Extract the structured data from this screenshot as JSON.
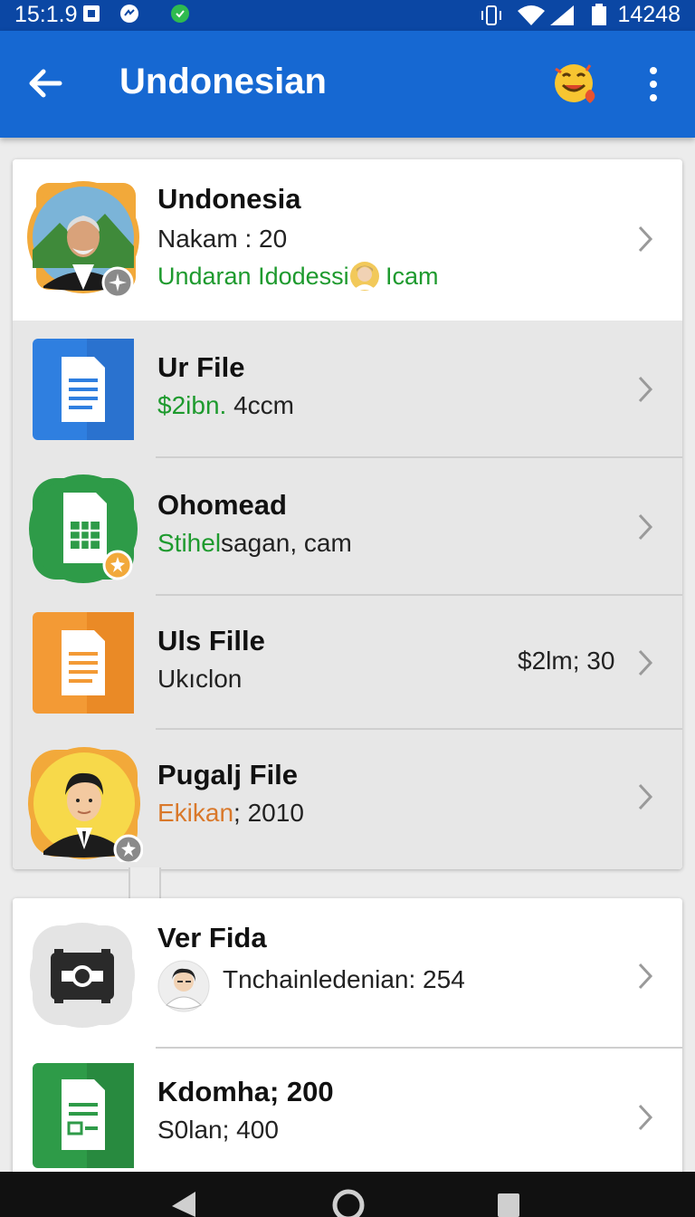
{
  "status_bar": {
    "time": "15:1.9",
    "right_time": "14248"
  },
  "app_bar": {
    "title": "Undonesian",
    "back_icon": "arrow-left-icon",
    "emoji_icon": "smiley-emoji-icon",
    "more_icon": "more-vertical-icon"
  },
  "colors": {
    "app_bar": "#1668d2",
    "status_bar": "#0b47a4",
    "green_text": "#1e9a2e",
    "orange_text": "#d9782a",
    "red_text": "#cc1f1a"
  },
  "card1": {
    "profile": {
      "name": "Undonesia",
      "subtitle": "Nakam : 20",
      "tag_left": "Undaran Idodessi",
      "tag_right": "Icam"
    },
    "items": [
      {
        "title": "Ur File",
        "sub_green": "$2ibn.",
        "sub_rest": " 4ccm",
        "icon": "docs-icon"
      },
      {
        "title": "Ohomead",
        "sub_green": "Stihel",
        "sub_rest": "sagan, cam",
        "icon": "sheets-icon"
      },
      {
        "title": "Uls Fille",
        "sub_rest": "Ukıclon",
        "trailing": "$2lm; 30",
        "icon": "slides-doc-icon"
      },
      {
        "title": "Pugalj File",
        "sub_orange": "Ekikan",
        "sub_rest": "; 2010",
        "icon": "avatar-icon"
      }
    ]
  },
  "card2": {
    "items": [
      {
        "title": "Ver Fida",
        "sub_rest": "Tnchainledenian: 254",
        "icon": "camera-icon"
      },
      {
        "title": "Kdomha; 200",
        "sub_rest": "S0lan; 400",
        "icon": "forms-icon"
      }
    ]
  }
}
